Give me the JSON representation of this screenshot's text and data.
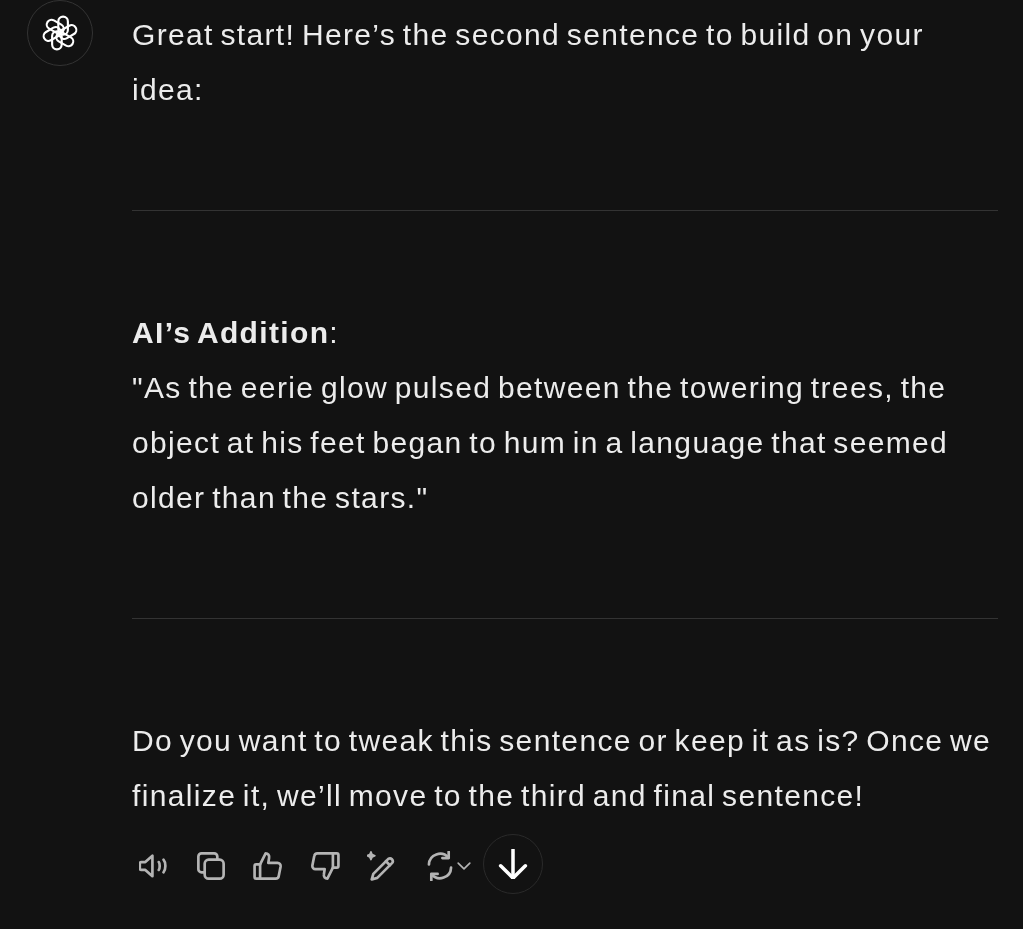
{
  "blocks": [
    {
      "kind": "paragraph",
      "text": "Great start! Here’s the second sentence to build on your idea:"
    },
    {
      "kind": "rule"
    },
    {
      "kind": "paragraph",
      "text": "**AI’s Addition**:"
    },
    {
      "kind": "paragraph",
      "text": "\"As the eerie glow pulsed between the towering trees, the object at his feet began to hum in a language that seemed older than the stars.\""
    },
    {
      "kind": "rule"
    },
    {
      "kind": "paragraph",
      "text": "Do you want to tweak this sentence or keep it as is? Once we finalize it, we’ll move to the third and final sentence!"
    }
  ],
  "actions": [
    {
      "kind": "read-aloud"
    },
    {
      "kind": "copy"
    },
    {
      "kind": "like"
    },
    {
      "kind": "dislike"
    },
    {
      "kind": "edit"
    },
    {
      "kind": "regenerate"
    }
  ],
  "scroll_button": {
    "kind": "down"
  }
}
